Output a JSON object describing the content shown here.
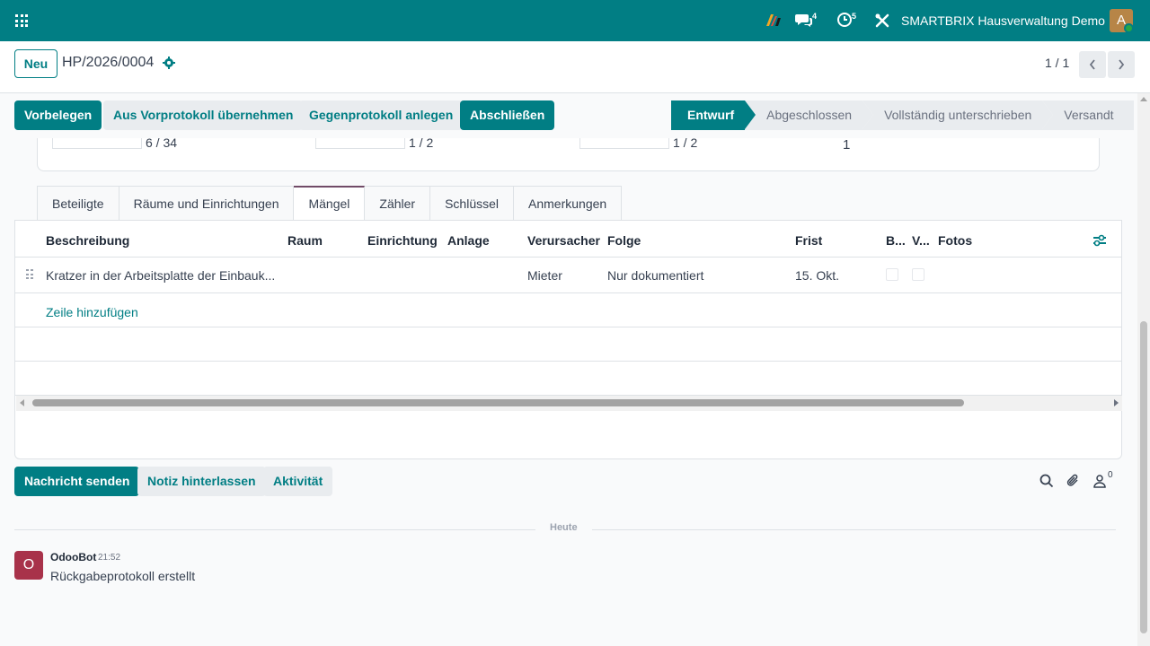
{
  "navbar": {
    "company": "SMARTBRIX Hausverwaltung Demo",
    "messages_count": "4",
    "activities_count": "5",
    "user_initial": "A"
  },
  "control": {
    "new_label": "Neu",
    "record_name": "HP/2026/0004",
    "pager": "1 / 1"
  },
  "statusbar": {
    "buttons": [
      "Vorbelegen",
      "Aus Vorprotokoll übernehmen",
      "Gegenprotokoll anlegen",
      "Abschließen"
    ],
    "steps": [
      "Entwurf",
      "Abgeschlossen",
      "Vollständig unterschrieben",
      "Versandt"
    ],
    "active_step": "Entwurf"
  },
  "summary": {
    "counts": [
      "6 / 34",
      "1 / 2",
      "1 / 2",
      "1"
    ]
  },
  "tabs": [
    "Beteiligte",
    "Räume und Einrichtungen",
    "Mängel",
    "Zähler",
    "Schlüssel",
    "Anmerkungen"
  ],
  "active_tab": "Mängel",
  "table": {
    "columns": [
      "Beschreibung",
      "Raum",
      "Einrichtung",
      "Anlage",
      "Verursacher",
      "Folge",
      "Frist",
      "B...",
      "V...",
      "Fotos"
    ],
    "rows": [
      {
        "beschreibung": "Kratzer in der Arbeitsplatte der Einbauk...",
        "raum": "",
        "einrichtung": "",
        "anlage": "",
        "verursacher": "Mieter",
        "folge": "Nur dokumentiert",
        "frist": "15. Okt."
      }
    ],
    "add_line": "Zeile hinzufügen"
  },
  "chatter": {
    "send_message": "Nachricht senden",
    "log_note": "Notiz hinterlassen",
    "activity": "Aktivität",
    "followers": "0",
    "date_separator": "Heute",
    "messages": [
      {
        "author": "OdooBot",
        "initial": "O",
        "time": "21:52",
        "body": "Rückgabeprotokoll erstellt"
      }
    ]
  },
  "colors": {
    "brand": "#017e84",
    "tab_accent": "#714b67",
    "bot_avatar": "#a8324a"
  }
}
